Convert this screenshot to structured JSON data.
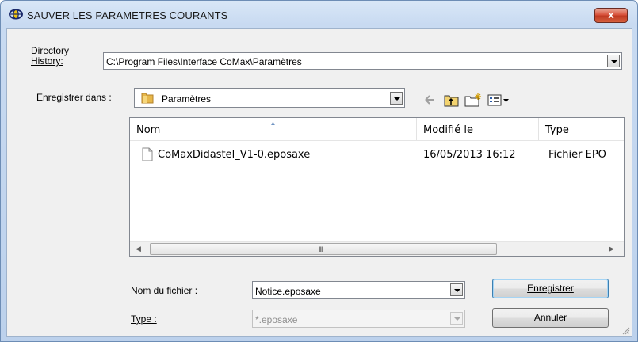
{
  "window": {
    "title": "SAUVER LES PARAMETRES COURANTS",
    "close_label": "x"
  },
  "directory_history": {
    "label_line1": "Directory",
    "label_line2": "History:",
    "value": "C:\\Program Files\\Interface CoMax\\Paramètres"
  },
  "save_in": {
    "label": "Enregistrer dans :",
    "folder": "Paramètres"
  },
  "toolbar": {
    "icons": [
      "back-arrow-icon",
      "up-folder-icon",
      "new-folder-icon",
      "view-menu-icon"
    ]
  },
  "file_list": {
    "columns": [
      "Nom",
      "Modifié le",
      "Type"
    ],
    "rows": [
      {
        "name": "CoMaxDidastel_V1-0.eposaxe",
        "modified": "16/05/2013 16:12",
        "type": "Fichier EPO"
      }
    ],
    "scroll_grip": "III"
  },
  "file_name": {
    "label": "Nom du fichier :",
    "value": "Notice.eposaxe"
  },
  "file_type": {
    "label": "Type :",
    "value": "*.eposaxe"
  },
  "buttons": {
    "save": "Enregistrer",
    "cancel": "Annuler"
  },
  "colors": {
    "accent": "#3c7fb1",
    "close": "#c9452d",
    "title_bar": "#c8daf1"
  }
}
